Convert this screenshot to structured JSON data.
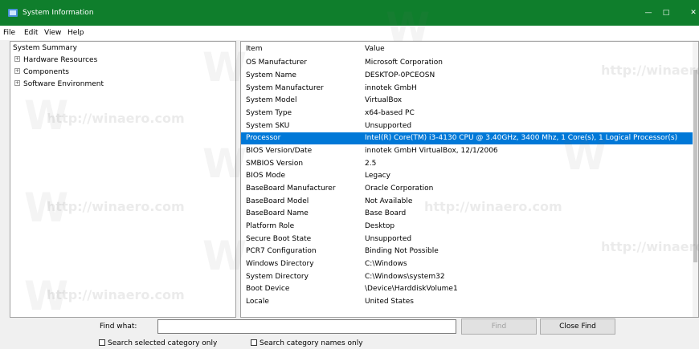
{
  "window": {
    "title": "System Information",
    "controls": {
      "minimize": "—",
      "maximize": "□",
      "close": "✕"
    }
  },
  "menu": {
    "file": "File",
    "edit": "Edit",
    "view": "View",
    "help": "Help"
  },
  "tree": {
    "summary": "System Summary",
    "items": [
      {
        "toggle": "+",
        "label": "Hardware Resources"
      },
      {
        "toggle": "+",
        "label": "Components"
      },
      {
        "toggle": "+",
        "label": "Software Environment"
      }
    ]
  },
  "table": {
    "header": {
      "item": "Item",
      "value": "Value"
    },
    "rows": [
      {
        "item": "OS Manufacturer",
        "value": "Microsoft Corporation"
      },
      {
        "item": "System Name",
        "value": "DESKTOP-0PCEOSN"
      },
      {
        "item": "System Manufacturer",
        "value": "innotek GmbH"
      },
      {
        "item": "System Model",
        "value": "VirtualBox"
      },
      {
        "item": "System Type",
        "value": "x64-based PC"
      },
      {
        "item": "System SKU",
        "value": "Unsupported"
      },
      {
        "item": "Processor",
        "value": "Intel(R) Core(TM) i3-4130 CPU @ 3.40GHz, 3400 Mhz, 1 Core(s), 1 Logical Processor(s)"
      },
      {
        "item": "BIOS Version/Date",
        "value": "innotek GmbH VirtualBox, 12/1/2006"
      },
      {
        "item": "SMBIOS Version",
        "value": "2.5"
      },
      {
        "item": "BIOS Mode",
        "value": "Legacy"
      },
      {
        "item": "BaseBoard Manufacturer",
        "value": "Oracle Corporation"
      },
      {
        "item": "BaseBoard Model",
        "value": "Not Available"
      },
      {
        "item": "BaseBoard Name",
        "value": "Base Board"
      },
      {
        "item": "Platform Role",
        "value": "Desktop"
      },
      {
        "item": "Secure Boot State",
        "value": "Unsupported"
      },
      {
        "item": "PCR7 Configuration",
        "value": "Binding Not Possible"
      },
      {
        "item": "Windows Directory",
        "value": "C:\\Windows"
      },
      {
        "item": "System Directory",
        "value": "C:\\Windows\\system32"
      },
      {
        "item": "Boot Device",
        "value": "\\Device\\HarddiskVolume1"
      },
      {
        "item": "Locale",
        "value": "United States"
      }
    ]
  },
  "find": {
    "label": "Find what:",
    "value": "",
    "find_button": "Find",
    "close_button": "Close Find",
    "search_selected": "Search selected category only",
    "search_names": "Search category names only"
  },
  "watermark": {
    "text": "http://winaero.com",
    "letter": "W"
  },
  "colors": {
    "titlebar": "#0f7e2c",
    "selection": "#0078d7"
  }
}
